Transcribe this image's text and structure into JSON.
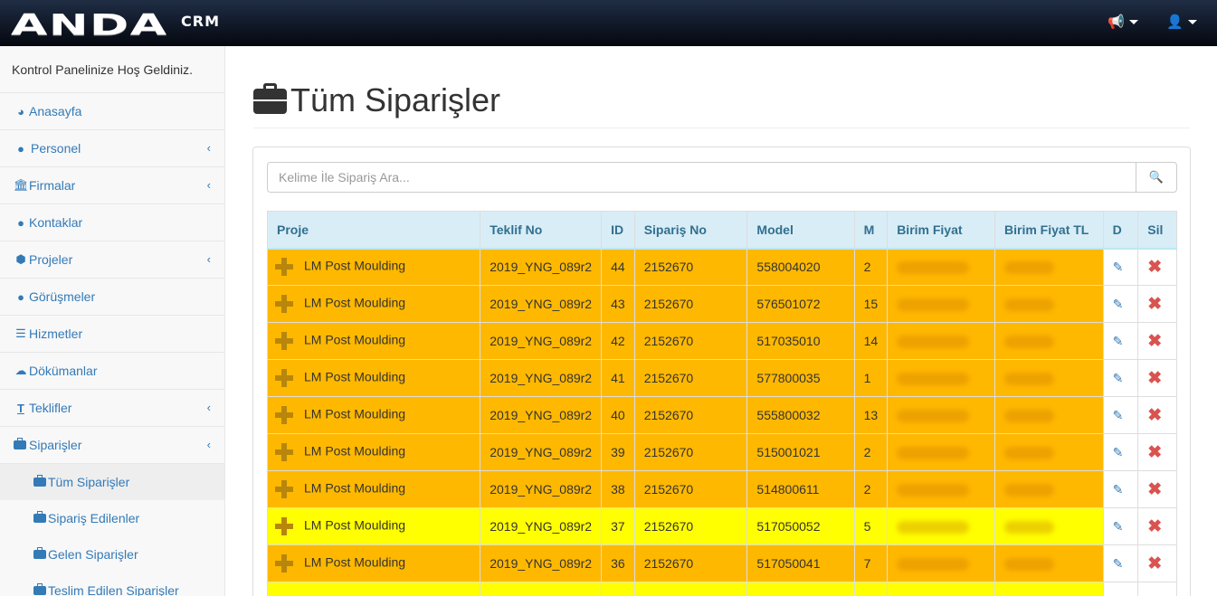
{
  "navbar": {
    "brand": "ANDA",
    "brand_sub": "CRM",
    "notifications_icon": "bullhorn-icon",
    "user_icon": "user-icon"
  },
  "sidebar": {
    "welcome": "Kontrol Panelinize Hoş Geldiniz.",
    "items": [
      {
        "label": "Anasayfa",
        "icon": "dashboard-icon"
      },
      {
        "label": "Personel",
        "icon": "user-icon",
        "arrow": "‹"
      },
      {
        "label": "Firmalar",
        "icon": "bank-icon",
        "arrow": "‹"
      },
      {
        "label": "Kontaklar",
        "icon": "users-icon"
      },
      {
        "label": "Projeler",
        "icon": "cube-icon",
        "arrow": "‹"
      },
      {
        "label": "Görüşmeler",
        "icon": "comments-icon"
      },
      {
        "label": "Hizmetler",
        "icon": "list-icon"
      },
      {
        "label": "Dökümanlar",
        "icon": "cloud-download-icon"
      },
      {
        "label": "Teklifler",
        "icon": "text-icon",
        "arrow": "‹"
      },
      {
        "label": "Siparişler",
        "icon": "briefcase-icon",
        "arrow": "‹"
      }
    ],
    "subitems": [
      {
        "label": "Tüm Siparişler"
      },
      {
        "label": "Sipariş Edilenler"
      },
      {
        "label": "Gelen Siparişler"
      },
      {
        "label": "Teslim Edilen Siparişler"
      }
    ]
  },
  "main": {
    "title": "Tüm Siparişler",
    "search_placeholder": "Kelime İle Sipariş Ara...",
    "columns": [
      "Proje",
      "Teklif No",
      "ID",
      "Sipariş No",
      "Model",
      "M",
      "Birim Fiyat",
      "Birim Fiyat TL",
      "D",
      "Sil"
    ],
    "rows": [
      {
        "proje": "LM Post Moulding",
        "teklif": "2019_YNG_089r2",
        "id": "44",
        "siparis": "2152670",
        "model": "558004020",
        "m": "2",
        "color": "orange"
      },
      {
        "proje": "LM Post Moulding",
        "teklif": "2019_YNG_089r2",
        "id": "43",
        "siparis": "2152670",
        "model": "576501072",
        "m": "15",
        "color": "orange"
      },
      {
        "proje": "LM Post Moulding",
        "teklif": "2019_YNG_089r2",
        "id": "42",
        "siparis": "2152670",
        "model": "517035010",
        "m": "14",
        "color": "orange"
      },
      {
        "proje": "LM Post Moulding",
        "teklif": "2019_YNG_089r2",
        "id": "41",
        "siparis": "2152670",
        "model": "577800035",
        "m": "1",
        "color": "orange"
      },
      {
        "proje": "LM Post Moulding",
        "teklif": "2019_YNG_089r2",
        "id": "40",
        "siparis": "2152670",
        "model": "555800032",
        "m": "13",
        "color": "orange"
      },
      {
        "proje": "LM Post Moulding",
        "teklif": "2019_YNG_089r2",
        "id": "39",
        "siparis": "2152670",
        "model": "515001021",
        "m": "2",
        "color": "orange"
      },
      {
        "proje": "LM Post Moulding",
        "teklif": "2019_YNG_089r2",
        "id": "38",
        "siparis": "2152670",
        "model": "514800611",
        "m": "2",
        "color": "orange"
      },
      {
        "proje": "LM Post Moulding",
        "teklif": "2019_YNG_089r2",
        "id": "37",
        "siparis": "2152670",
        "model": "517050052",
        "m": "5",
        "color": "yellow"
      },
      {
        "proje": "LM Post Moulding",
        "teklif": "2019_YNG_089r2",
        "id": "36",
        "siparis": "2152670",
        "model": "517050041",
        "m": "7",
        "color": "orange"
      },
      {
        "proje": "",
        "teklif": "",
        "id": "",
        "siparis": "",
        "model": "",
        "m": "",
        "color": "yellow"
      }
    ],
    "colors": {
      "orange": "#ffb800",
      "yellow": "#ffff00",
      "header": "#d9edf7",
      "link": "#337ab7",
      "delete": "#d9534f"
    }
  }
}
